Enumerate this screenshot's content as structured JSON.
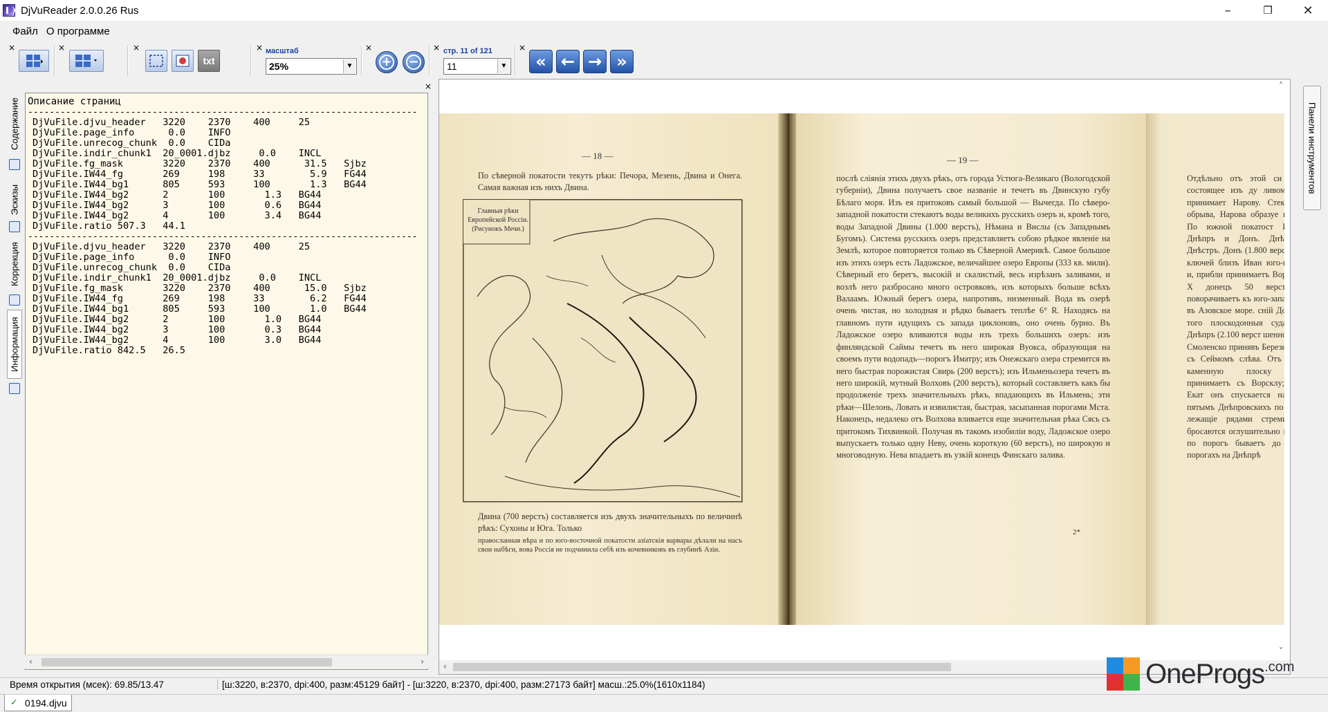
{
  "window": {
    "title": "DjVuReader 2.0.0.26 Rus",
    "minimize": "–",
    "restore": "❐",
    "close": "✕"
  },
  "menu": {
    "items": [
      "Файл",
      "О программе"
    ]
  },
  "toolbar": {
    "close_glyph": "×",
    "text_mode_label": "txt",
    "zoom_label": "масштаб",
    "zoom_value": "25%",
    "page_label": "стр. 11 of 121",
    "page_value": "11",
    "zoom_in_glyph": "+",
    "zoom_out_glyph": "−",
    "nav": {
      "first": "«",
      "prev": "←",
      "next": "→",
      "last": "»"
    }
  },
  "left_tabs": [
    "Содержание",
    "Эскизы",
    "Коррекция",
    "Информация"
  ],
  "info_panel": {
    "title": "Описание страниц",
    "block1": [
      "DjVuFile.djvu_header   3220    2370    400     25",
      "DjVuFile.page_info      0.0    INFO",
      "DjVuFile.unrecog_chunk  0.0    CIDa",
      "DjVuFile.indir_chunk1  20_0001.djbz     0.0    INCL",
      "DjVuFile.fg_mask       3220    2370    400      31.5   Sjbz",
      "DjVuFile.IW44_fg       269     198     33        5.9   FG44",
      "DjVuFile.IW44_bg1      805     593     100       1.3   BG44",
      "DjVuFile.IW44_bg2      2       100       1.3   BG44",
      "DjVuFile.IW44_bg2      3       100       0.6   BG44",
      "DjVuFile.IW44_bg2      4       100       3.4   BG44",
      "DjVuFile.ratio 507.3   44.1"
    ],
    "block2": [
      "DjVuFile.djvu_header   3220    2370    400     25",
      "DjVuFile.page_info      0.0    INFO",
      "DjVuFile.unrecog_chunk  0.0    CIDa",
      "DjVuFile.indir_chunk1  20_0001.djbz     0.0    INCL",
      "DjVuFile.fg_mask       3220    2370    400      15.0   Sjbz",
      "DjVuFile.IW44_fg       269     198     33        6.2   FG44",
      "DjVuFile.IW44_bg1      805     593     100       1.0   BG44",
      "DjVuFile.IW44_bg2      2       100       1.0   BG44",
      "DjVuFile.IW44_bg2      3       100       0.3   BG44",
      "DjVuFile.IW44_bg2      4       100       3.0   BG44",
      "DjVuFile.ratio 842.5   26.5"
    ],
    "separator": "------------------------------------------------------------------------"
  },
  "document": {
    "left_page_number": "— 18 —",
    "left_intro": "По сѣверной покатости текутъ рѣки: Печора, Мезень, Двина и Онега. Самая важная изъ нихъ Двина.",
    "map_caption": "Главныя рѣки Европейской Россіи. (Рисунокъ Мечи.)",
    "left_bottom": "Двина (700 верстъ) составляется изъ двухъ значительныхъ по величинѣ рѣкъ: Сухоны и Юга. Только",
    "left_footnote": "правосланная вѣра и по юго-восточной покатости азіатскія варвары дѣлали на насъ свои набѣги, вова Россія не подчинила себѣ изъ кочевниковъ въ глубинѣ Азіи.",
    "mid_page_number": "— 19 —",
    "mid_text": "послѣ слiянiя этихъ двухъ рѣкъ, отъ города Устюга-Великаго (Вологодской губернiи), Двина получаетъ свое названiе и течетъ въ Двинскую губу Бѣлаго моря. Изъ ея притоковъ самый большой — Вычегда. По сѣверо-западной покатости стекаютъ воды великихъ русскихъ озеръ и, кромѣ того, воды Западной Двины (1.000 верстъ), Нѣмана и Вислы (съ Западнымъ Бугомъ). Система русскихъ озеръ представляетъ собою рѣдкое явленiе на Землѣ, которое повторяется только въ Сѣверной Америкѣ. Самое большое изъ этихъ озеръ есть Ладожское, величайшее озеро Европы (333 кв. мили). Сѣверный его берегъ, высокiй и скалистый, весь изрѣзанъ заливами, и возлѣ него разбросано много островковъ, изъ которыхъ больше всѣхъ Валаамъ. Южный берегъ озера, напротивъ, низменный. Вода въ озерѣ очень чистая, но холодная и рѣдко бываетъ теплѣе 6° R. Находясь на главномъ пути идущихъ съ запада циклоновъ, оно очень бурно. Въ Ладожское озеро вливаются воды изъ трехъ большихъ озеръ: изъ финляндской Саймы течетъ въ него широкая Вуокса, образующая на своемъ пути водопадъ—порогъ Иматру; изъ Онежскаго озера стремится въ него быстрая порожистая Свирь (200 верстъ); изъ Ильменьозера течетъ въ него широкiй, мутный Волховъ (200 верстъ), который составляетъ какъ бы продолженiе трехъ значительныхъ рѣкъ, впадающихъ въ Ильмень; эти рѣки—Шелонь, Ловать и извилистая, быстрая, засыпанная порогами Мста. Наконецъ, недалеко отъ Волхова вливается еще значительная рѣка Сясь съ притокомъ Тихвинкой. Получая въ такомъ изобилiи воду, Ладожское озеро выпускаетъ только одну Неву, очень короткую (60 верстъ), но широкую и многоводную. Нева впадаетъ въ узкiй конецъ Финскаго залива.",
    "mid_signature": "2*",
    "right_text": "Отдѣльно отъ этой си озеро, состоящее изъ ду ливомъ; оно принимает Нарову. Стекая изъ обрыва, Нарова образуе шиною. По южной покатост Ингулъ, Днѣпръ и Донъ. Днѣпръ и Днѣстръ. Донъ (1.800 верстъ) изъ ключей близъ Иван юго-востоку и, прибли принимаетъ Воронежъ, Х донецъ 50 верстъ до поворачиваетъ къ юго-запа вается въ Азовское море. сній Донъ» до того плоскодонныя суда една Днѣпръ (2.100 верст шенности, въ Смоленско принявъ Березину и П съ Сеймомъ слѣва. Отъ огибая каменную плоску пути принимаетъ съ Ворсклу; около Екат онъ спускается на Черн пятымъ Днѣпровскихъ по камни, лежащіе рядами стремительно бросаются оглушительно шумя и по порогъ бываетъ до 13 ва порогахъ на Днѣпрѣ"
  },
  "right_panel_tab": "Панели инструментов",
  "status": {
    "open_time": "Время открытия (мсек): 69.85/13.47",
    "details": "[ш:3220, в:2370, dpi:400, разм:45129 байт] - [ш:3220, в:2370, dpi:400, разм:27173 байт] масш.:25.0%(1610x1184)"
  },
  "file_tab": {
    "name": "0194.djvu",
    "check": "✓"
  },
  "watermark": {
    "text": "OneProgs",
    "suffix": ".com"
  }
}
